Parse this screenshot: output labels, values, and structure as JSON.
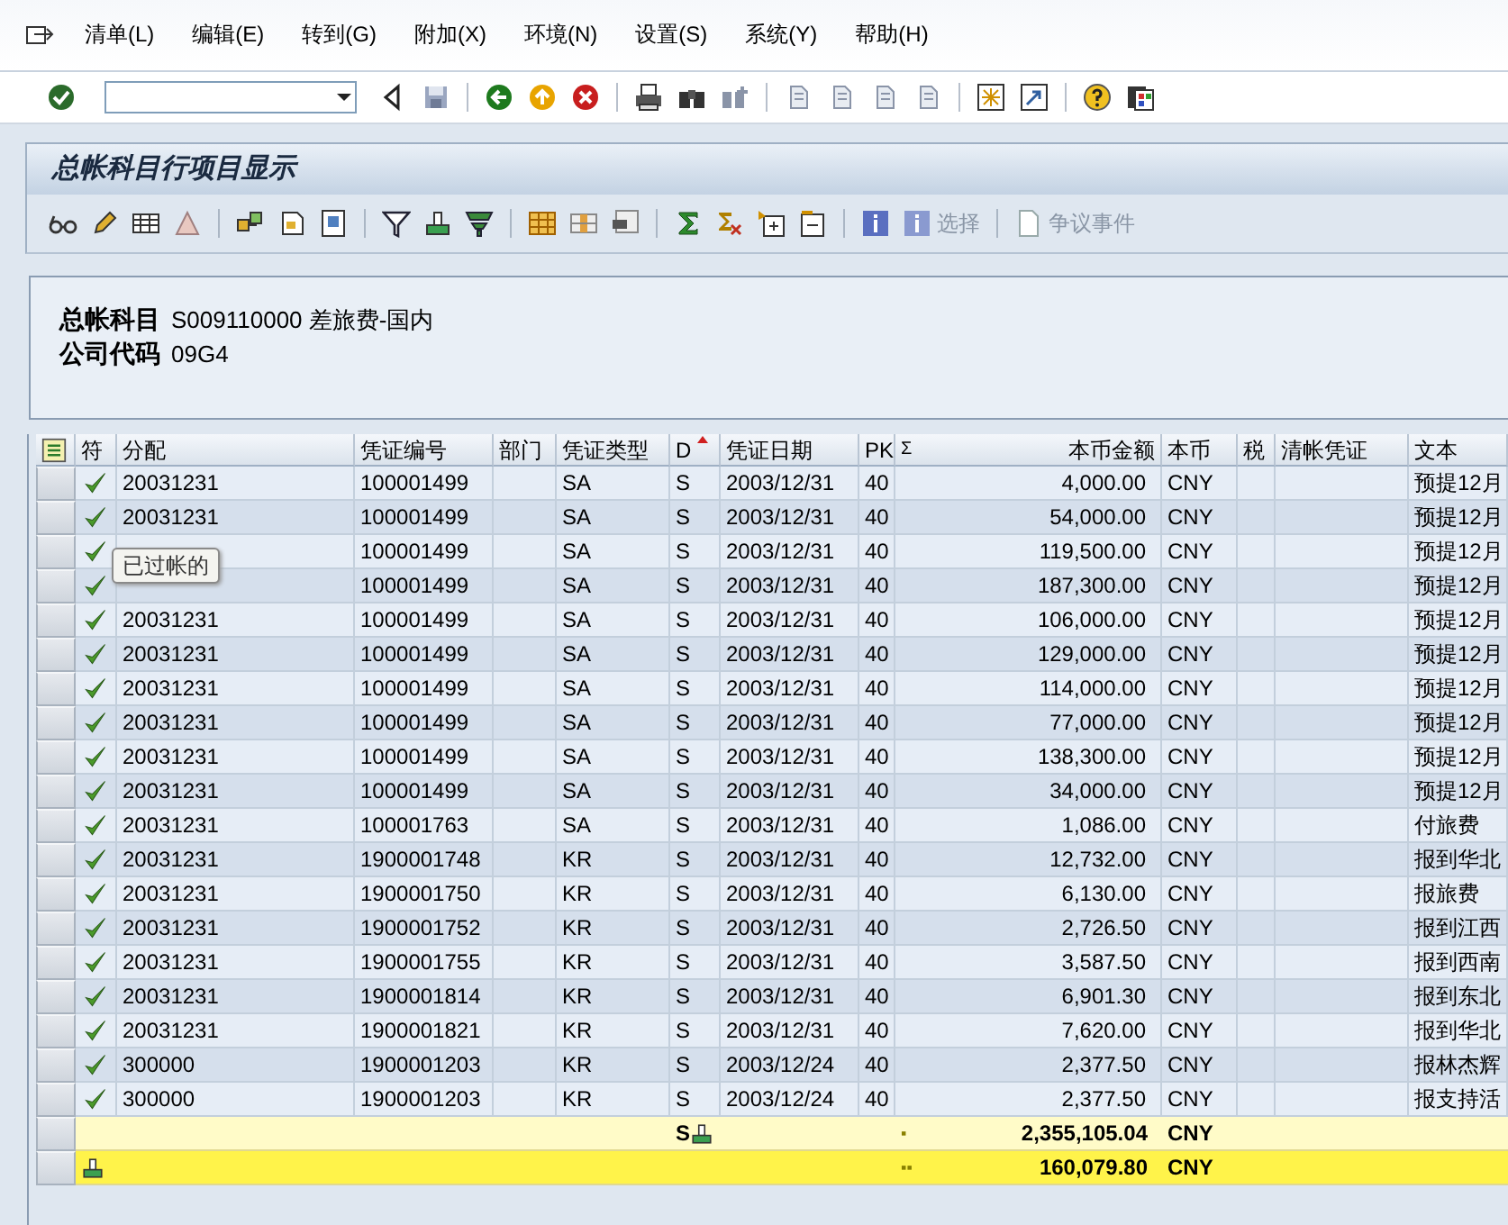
{
  "menu": [
    {
      "label": "清单(L)"
    },
    {
      "label": "编辑(E)"
    },
    {
      "label": "转到(G)"
    },
    {
      "label": "附加(X)"
    },
    {
      "label": "环境(N)"
    },
    {
      "label": "设置(S)"
    },
    {
      "label": "系统(Y)"
    },
    {
      "label": "帮助(H)"
    }
  ],
  "title": "总帐科目行项目显示",
  "app_buttons": [
    {
      "label": "选择",
      "disabled": true
    },
    {
      "label": "争议事件",
      "disabled": true
    }
  ],
  "header": {
    "fields": [
      {
        "label": "总帐科目",
        "value": "S009110000 差旅费-国内"
      },
      {
        "label": "公司代码",
        "value": "09G4"
      }
    ]
  },
  "table": {
    "columns": [
      {
        "label": "符",
        "sorted": false
      },
      {
        "label": "分配",
        "sorted": false
      },
      {
        "label": "凭证编号",
        "sorted": false
      },
      {
        "label": "部门",
        "sorted": false
      },
      {
        "label": "凭证类型",
        "sorted": false
      },
      {
        "label": "D",
        "sorted": true
      },
      {
        "label": "凭证日期",
        "sorted": false
      },
      {
        "label": "PK",
        "sorted": false
      },
      {
        "label": "本币金额",
        "sorted": false,
        "sum_mark": "Σ"
      },
      {
        "label": "本币",
        "sorted": false
      },
      {
        "label": "税",
        "sorted": false
      },
      {
        "label": "清帐凭证",
        "sorted": false
      },
      {
        "label": "文本",
        "sorted": false
      }
    ],
    "rows": [
      {
        "posted": true,
        "assignment": "20031231",
        "document_number": "100001499",
        "document_type": "SA",
        "debit_credit": "S",
        "document_date": "2003/12/31",
        "posting_key": "40",
        "amount": "4,000.00",
        "currency": "CNY",
        "text": "预提12月"
      },
      {
        "posted": true,
        "assignment": "20031231",
        "document_number": "100001499",
        "document_type": "SA",
        "debit_credit": "S",
        "document_date": "2003/12/31",
        "posting_key": "40",
        "amount": "54,000.00",
        "currency": "CNY",
        "text": "预提12月"
      },
      {
        "posted": true,
        "document_number": "100001499",
        "document_type": "SA",
        "debit_credit": "S",
        "document_date": "2003/12/31",
        "posting_key": "40",
        "amount": "119,500.00",
        "currency": "CNY",
        "text": "预提12月"
      },
      {
        "posted": true,
        "document_number": "100001499",
        "document_type": "SA",
        "debit_credit": "S",
        "document_date": "2003/12/31",
        "posting_key": "40",
        "amount": "187,300.00",
        "currency": "CNY",
        "text": "预提12月"
      },
      {
        "posted": true,
        "assignment": "20031231",
        "document_number": "100001499",
        "document_type": "SA",
        "debit_credit": "S",
        "document_date": "2003/12/31",
        "posting_key": "40",
        "amount": "106,000.00",
        "currency": "CNY",
        "text": "预提12月"
      },
      {
        "posted": true,
        "assignment": "20031231",
        "document_number": "100001499",
        "document_type": "SA",
        "debit_credit": "S",
        "document_date": "2003/12/31",
        "posting_key": "40",
        "amount": "129,000.00",
        "currency": "CNY",
        "text": "预提12月"
      },
      {
        "posted": true,
        "assignment": "20031231",
        "document_number": "100001499",
        "document_type": "SA",
        "debit_credit": "S",
        "document_date": "2003/12/31",
        "posting_key": "40",
        "amount": "114,000.00",
        "currency": "CNY",
        "text": "预提12月"
      },
      {
        "posted": true,
        "assignment": "20031231",
        "document_number": "100001499",
        "document_type": "SA",
        "debit_credit": "S",
        "document_date": "2003/12/31",
        "posting_key": "40",
        "amount": "77,000.00",
        "currency": "CNY",
        "text": "预提12月"
      },
      {
        "posted": true,
        "assignment": "20031231",
        "document_number": "100001499",
        "document_type": "SA",
        "debit_credit": "S",
        "document_date": "2003/12/31",
        "posting_key": "40",
        "amount": "138,300.00",
        "currency": "CNY",
        "text": "预提12月"
      },
      {
        "posted": true,
        "assignment": "20031231",
        "document_number": "100001499",
        "document_type": "SA",
        "debit_credit": "S",
        "document_date": "2003/12/31",
        "posting_key": "40",
        "amount": "34,000.00",
        "currency": "CNY",
        "text": "预提12月"
      },
      {
        "posted": true,
        "assignment": "20031231",
        "document_number": "100001763",
        "document_type": "SA",
        "debit_credit": "S",
        "document_date": "2003/12/31",
        "posting_key": "40",
        "amount": "1,086.00",
        "currency": "CNY",
        "text": "付旅费"
      },
      {
        "posted": true,
        "assignment": "20031231",
        "document_number": "1900001748",
        "document_type": "KR",
        "debit_credit": "S",
        "document_date": "2003/12/31",
        "posting_key": "40",
        "amount": "12,732.00",
        "currency": "CNY",
        "text": "报到华北"
      },
      {
        "posted": true,
        "assignment": "20031231",
        "document_number": "1900001750",
        "document_type": "KR",
        "debit_credit": "S",
        "document_date": "2003/12/31",
        "posting_key": "40",
        "amount": "6,130.00",
        "currency": "CNY",
        "text": "报旅费"
      },
      {
        "posted": true,
        "assignment": "20031231",
        "document_number": "1900001752",
        "document_type": "KR",
        "debit_credit": "S",
        "document_date": "2003/12/31",
        "posting_key": "40",
        "amount": "2,726.50",
        "currency": "CNY",
        "text": "报到江西"
      },
      {
        "posted": true,
        "assignment": "20031231",
        "document_number": "1900001755",
        "document_type": "KR",
        "debit_credit": "S",
        "document_date": "2003/12/31",
        "posting_key": "40",
        "amount": "3,587.50",
        "currency": "CNY",
        "text": "报到西南"
      },
      {
        "posted": true,
        "assignment": "20031231",
        "document_number": "1900001814",
        "document_type": "KR",
        "debit_credit": "S",
        "document_date": "2003/12/31",
        "posting_key": "40",
        "amount": "6,901.30",
        "currency": "CNY",
        "text": "报到东北"
      },
      {
        "posted": true,
        "assignment": "20031231",
        "document_number": "1900001821",
        "document_type": "KR",
        "debit_credit": "S",
        "document_date": "2003/12/31",
        "posting_key": "40",
        "amount": "7,620.00",
        "currency": "CNY",
        "text": "报到华北"
      },
      {
        "posted": true,
        "assignment": "300000",
        "document_number": "1900001203",
        "document_type": "KR",
        "debit_credit": "S",
        "document_date": "2003/12/24",
        "posting_key": "40",
        "amount": "2,377.50",
        "currency": "CNY",
        "text": "报林杰辉"
      },
      {
        "posted": true,
        "assignment": "300000",
        "document_number": "1900001203",
        "document_type": "KR",
        "debit_credit": "S",
        "document_date": "2003/12/24",
        "posting_key": "40",
        "amount": "2,377.50",
        "currency": "CNY",
        "text": "报支持活"
      }
    ],
    "totals": [
      {
        "kind": "subtotal",
        "debit_credit": "S",
        "marker": "▪",
        "amount": "2,355,105.04",
        "currency": "CNY"
      },
      {
        "kind": "grand_total",
        "marker": "▪▪",
        "amount": "160,079.80",
        "currency": "CNY"
      }
    ]
  },
  "tooltip": {
    "text": "已过帐的"
  }
}
